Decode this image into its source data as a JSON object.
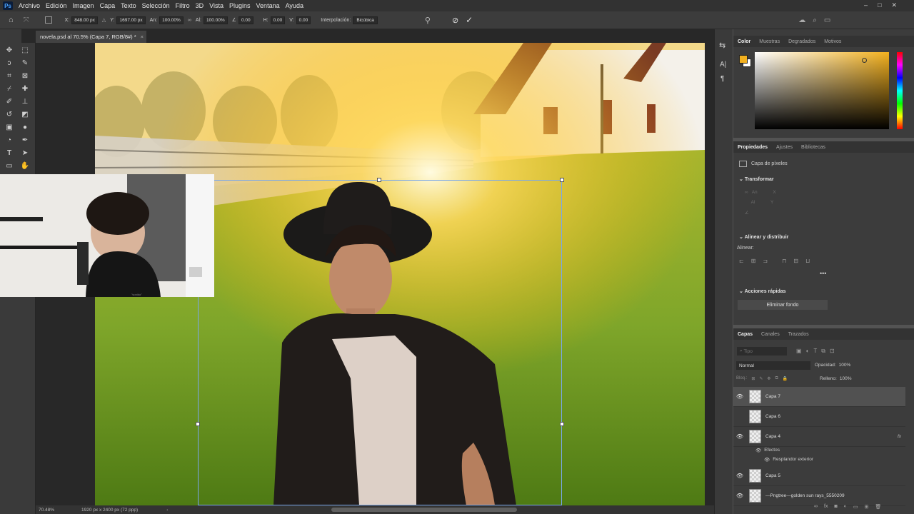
{
  "menu": [
    "Archivo",
    "Edición",
    "Imagen",
    "Capa",
    "Texto",
    "Selección",
    "Filtro",
    "3D",
    "Vista",
    "Plugins",
    "Ventana",
    "Ayuda"
  ],
  "options": {
    "x_label": "X:",
    "x_value": "848.00 px",
    "y_label": "Y:",
    "y_value": "1697.00 px",
    "w_label": "An:",
    "w_value": "100.00%",
    "h_label": "Al:",
    "h_value": "100.00%",
    "angle_value": "0.00",
    "hskew_label": "H:",
    "hskew_value": "0.00",
    "vskew_label": "V:",
    "vskew_value": "0.00",
    "interp_label": "Interpolación:",
    "interp_value": "Bicúbica"
  },
  "document": {
    "tab_title": "novela.psd al 70.5% (Capa 7, RGB/8#) *"
  },
  "status": {
    "zoom": "70.48%",
    "doc_size": "1920 px x 2400 px (72 ppp)"
  },
  "color_panel": {
    "tabs": [
      "Color",
      "Muestras",
      "Degradados",
      "Motivos"
    ],
    "foreground": "#f2b01e",
    "background": "#ffffff"
  },
  "properties": {
    "tabs": [
      "Propiedades",
      "Ajustes",
      "Bibliotecas"
    ],
    "layer_type": "Capa de píxeles",
    "transform_title": "Transformar",
    "align_title": "Alinear y distribuir",
    "align_label": "Alinear:",
    "quick_title": "Acciones rápidas",
    "remove_bg": "Eliminar fondo"
  },
  "layers_panel": {
    "tabs": [
      "Capas",
      "Canales",
      "Trazados"
    ],
    "search_placeholder": "Tipo",
    "blend_mode": "Normal",
    "opacity_label": "Opacidad:",
    "opacity_value": "100%",
    "lock_label": "Bloq.:",
    "fill_label": "Relleno:",
    "fill_value": "100%",
    "layers": [
      {
        "name": "Capa 7",
        "visible": true
      },
      {
        "name": "Capa 6",
        "visible": false
      },
      {
        "name": "Capa 4",
        "visible": true
      },
      {
        "name": "Capa 5",
        "visible": true
      },
      {
        "name": "—Pngtree—golden sun rays_5550209",
        "visible": true
      }
    ],
    "effects_label": "Efectos",
    "effect_outer_glow": "Resplandor exterior"
  },
  "webcam": {
    "shirt_text": "\"sonido\""
  }
}
